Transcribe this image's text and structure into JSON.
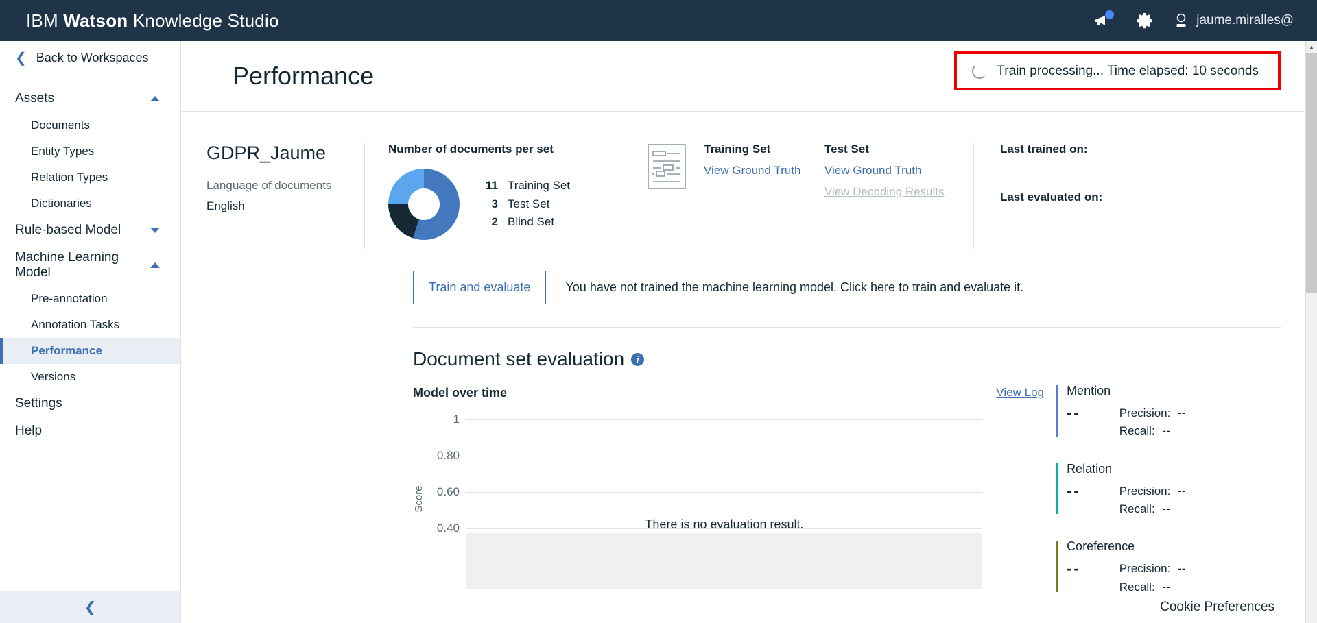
{
  "header": {
    "brand_prefix": "IBM ",
    "brand_bold": "Watson",
    "brand_suffix": " Knowledge Studio",
    "announcement_icon": "megaphone-icon",
    "settings_icon": "gear-icon",
    "user_icon": "user-avatar-icon",
    "user_name": "jaume.miralles@",
    "bar_color": "#1f3448"
  },
  "sidebar": {
    "back_label": "Back to Workspaces",
    "back_icon": "chevron-left-icon",
    "groups": [
      {
        "label": "Assets",
        "caret": "up",
        "items": [
          "Documents",
          "Entity Types",
          "Relation Types",
          "Dictionaries"
        ]
      },
      {
        "label": "Rule-based Model",
        "caret": "down",
        "items": []
      },
      {
        "label": "Machine Learning Model",
        "caret": "up",
        "items": [
          "Pre-annotation",
          "Annotation Tasks",
          "Performance",
          "Versions"
        ]
      }
    ],
    "active_item": "Performance",
    "top_links": [
      "Settings",
      "Help"
    ],
    "collapse_icon": "chevron-left-icon"
  },
  "page": {
    "title": "Performance",
    "status": {
      "spinner_icon": "loading-spinner-icon",
      "text": "Train processing... Time elapsed: 10 seconds",
      "highlight_color": "#ee0000"
    }
  },
  "summary": {
    "project_name": "GDPR_Jaume",
    "language_label": "Language of documents",
    "language_value": "English",
    "donut_title": "Number of documents per set",
    "sets": [
      {
        "count": "11",
        "label": "Training Set",
        "color": "#4178be"
      },
      {
        "count": "3",
        "label": "Test Set",
        "color": "#152935"
      },
      {
        "count": "2",
        "label": "Blind Set",
        "color": "#5aa7f0"
      }
    ],
    "doc_icon": "document-lines-icon",
    "set_columns": [
      {
        "title": "Training Set",
        "links": [
          {
            "label": "View Ground Truth",
            "disabled": false
          }
        ]
      },
      {
        "title": "Test Set",
        "links": [
          {
            "label": "View Ground Truth",
            "disabled": false
          },
          {
            "label": "View Decoding Results",
            "disabled": true
          }
        ]
      }
    ],
    "last_trained_label": "Last trained on:",
    "last_trained_value": "",
    "last_evaluated_label": "Last evaluated on:",
    "last_evaluated_value": ""
  },
  "train": {
    "button_label": "Train and evaluate",
    "hint": "You have not trained the machine learning model. Click here to train and evaluate it."
  },
  "evaluation": {
    "heading": "Document set evaluation",
    "info_icon": "info-icon",
    "chart_subtitle": "Model over time",
    "view_log_label": "View Log",
    "empty_message": "There is no evaluation result.",
    "metrics": [
      {
        "name": "Mention",
        "score": "--",
        "precision_label": "Precision:",
        "precision": "--",
        "recall_label": "Recall:",
        "recall": "--",
        "color": "#5a7fd1"
      },
      {
        "name": "Relation",
        "score": "--",
        "precision_label": "Precision:",
        "precision": "--",
        "recall_label": "Recall:",
        "recall": "--",
        "color": "#00b4a0"
      },
      {
        "name": "Coreference",
        "score": "--",
        "precision_label": "Precision:",
        "precision": "--",
        "recall_label": "Recall:",
        "recall": "--",
        "color": "#7c7c1e"
      }
    ]
  },
  "chart_data": {
    "type": "line",
    "title": "Model over time",
    "xlabel": "",
    "ylabel": "Score",
    "ylim": [
      0,
      1
    ],
    "yticks": [
      "1",
      "0.80",
      "0.60",
      "0.40"
    ],
    "ytick_values": [
      1,
      0.8,
      0.6,
      0.4
    ],
    "grid": true,
    "series": [
      {
        "name": "Mention",
        "values": []
      },
      {
        "name": "Relation",
        "values": []
      },
      {
        "name": "Coreference",
        "values": []
      }
    ],
    "annotation": "There is no evaluation result."
  },
  "footer": {
    "cookie_label": "Cookie Preferences"
  },
  "scrollbar": {
    "up_icon": "chevron-up-icon"
  }
}
